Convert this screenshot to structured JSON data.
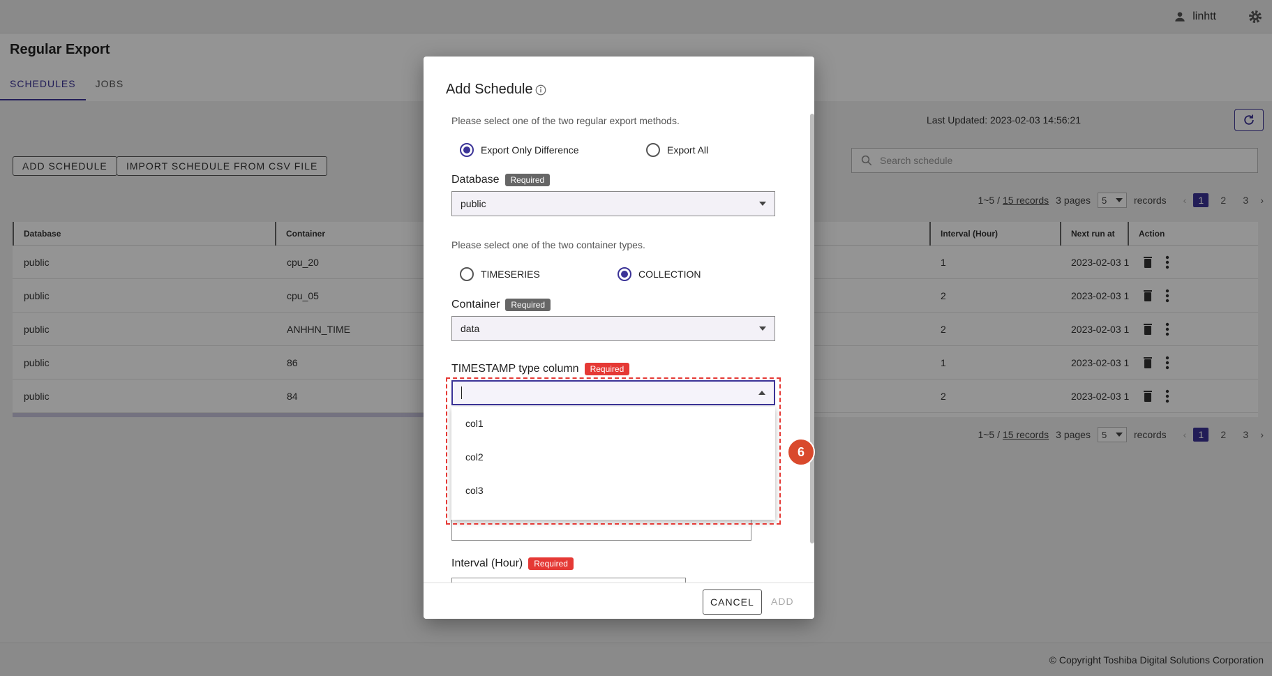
{
  "topbar": {
    "username": "linhtt",
    "user_icon": "person-icon",
    "settings_icon": "gear-icon"
  },
  "page": {
    "title": "Regular Export",
    "tabs": [
      {
        "label": "SCHEDULES",
        "active": true
      },
      {
        "label": "JOBS",
        "active": false
      }
    ]
  },
  "toolbar": {
    "last_updated": "Last Updated: 2023-02-03 14:56:21",
    "refresh_icon": "refresh-icon",
    "add_schedule": "ADD SCHEDULE",
    "import_csv": "IMPORT SCHEDULE FROM CSV FILE",
    "search_placeholder": "Search schedule"
  },
  "pagination": {
    "range": "1~5 /",
    "records_link": "15 records",
    "pages": "3 pages",
    "page_size": "5",
    "records_label": "records",
    "page_numbers": [
      "1",
      "2",
      "3"
    ],
    "current_page": "1"
  },
  "table": {
    "headers": {
      "database": "Database",
      "container": "Container",
      "interval": "Interval (Hour)",
      "next_run": "Next run at",
      "action": "Action"
    },
    "rows": [
      {
        "database": "public",
        "container": "cpu_20",
        "interval": "1",
        "next_run": "2023-02-03 1"
      },
      {
        "database": "public",
        "container": "cpu_05",
        "interval": "2",
        "next_run": "2023-02-03 1"
      },
      {
        "database": "public",
        "container": "ANHHN_TIME",
        "interval": "2",
        "next_run": "2023-02-03 1"
      },
      {
        "database": "public",
        "container": "86",
        "interval": "1",
        "next_run": "2023-02-03 1"
      },
      {
        "database": "public",
        "container": "84",
        "interval": "2",
        "next_run": "2023-02-03 1"
      }
    ]
  },
  "footer": {
    "copyright": "© Copyright Toshiba Digital Solutions Corporation"
  },
  "dialog": {
    "title": "Add Schedule",
    "export_hint": "Please select one of the two regular export methods.",
    "export_options": [
      {
        "label": "Export Only Difference",
        "checked": true
      },
      {
        "label": "Export All",
        "checked": false
      }
    ],
    "database_label": "Database",
    "required": "Required",
    "database_value": "public",
    "container_hint": "Please select one of the two container types.",
    "container_types": [
      {
        "label": "TIMESERIES",
        "checked": false
      },
      {
        "label": "COLLECTION",
        "checked": true
      }
    ],
    "container_label": "Container",
    "container_value": "data",
    "timestamp_label": "TIMESTAMP type column",
    "timestamp_value": "",
    "timestamp_options": [
      "col1",
      "col2",
      "col3"
    ],
    "interval_label": "Interval (Hour)",
    "cancel": "CANCEL",
    "add": "ADD"
  },
  "step_marker": "6",
  "colors": {
    "accent": "#3b3397",
    "required_red": "#e53935",
    "marker": "#d9492c"
  }
}
